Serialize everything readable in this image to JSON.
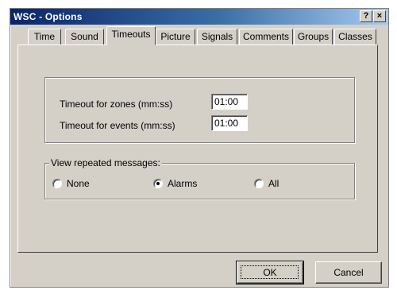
{
  "window": {
    "title": "WSC - Options",
    "help_label": "?",
    "close_label": "×"
  },
  "tabs": [
    {
      "label": "Time",
      "active": false
    },
    {
      "label": "Sound",
      "active": false
    },
    {
      "label": "Timeouts",
      "active": true
    },
    {
      "label": "Picture",
      "active": false
    },
    {
      "label": "Signals",
      "active": false
    },
    {
      "label": "Comments",
      "active": false
    },
    {
      "label": "Groups",
      "active": false
    },
    {
      "label": "Classes",
      "active": false
    }
  ],
  "timeouts": {
    "zones_label": "Timeout for zones (mm:ss)",
    "zones_value": "01:00",
    "events_label": "Timeout for events (mm:ss)",
    "events_value": "01:00"
  },
  "repeated_messages": {
    "legend": "View repeated messages:",
    "options": [
      {
        "label": "None",
        "checked": false
      },
      {
        "label": "Alarms",
        "checked": true
      },
      {
        "label": "All",
        "checked": false
      }
    ]
  },
  "buttons": {
    "ok_label": "OK",
    "cancel_label": "Cancel"
  },
  "colors": {
    "face": "#d4d0c8",
    "title_start": "#0a246a",
    "title_end": "#a6caf0"
  }
}
